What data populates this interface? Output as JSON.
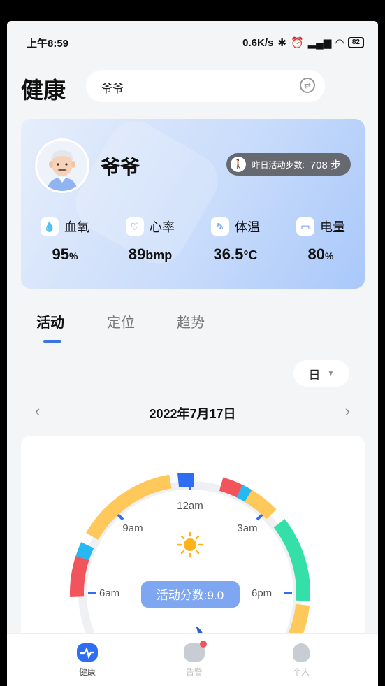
{
  "status": {
    "time": "上午8:59",
    "net_speed": "0.6K/s",
    "battery": "82"
  },
  "header": {
    "title": "健康",
    "search_value": "爷爷"
  },
  "profile": {
    "name": "爷爷",
    "steps_label": "昨日活动步数:",
    "steps_value": "708 步"
  },
  "metrics": [
    {
      "label": "血氧",
      "value": "95",
      "unit": "%",
      "icon": "droplet-icon"
    },
    {
      "label": "心率",
      "value": "89",
      "unit": "bmp",
      "icon": "heart-pulse-icon"
    },
    {
      "label": "体温",
      "value": "36.5",
      "unit": "°C",
      "icon": "thermometer-icon"
    },
    {
      "label": "电量",
      "value": "80",
      "unit": "%",
      "icon": "battery-icon"
    }
  ],
  "tabs": [
    {
      "label": "活动",
      "active": true
    },
    {
      "label": "定位",
      "active": false
    },
    {
      "label": "趋势",
      "active": false
    }
  ],
  "period": {
    "selected": "日"
  },
  "date": {
    "text": "2022年7月17日"
  },
  "chart": {
    "score_text": "活动分数:9.0",
    "labels": {
      "top": "12am",
      "tl": "9am",
      "tr": "3am",
      "left": "6am",
      "right": "6pm"
    },
    "colors": {
      "yellow": "#ffc85a",
      "blue": "#2f6ef0",
      "red": "#f2545b",
      "cyan": "#26b8f0",
      "green": "#34dfa8",
      "track": "#eef0f4",
      "badge": "#7fa6f0"
    }
  },
  "nav": [
    {
      "label": "健康",
      "icon": "heart-pulse-icon",
      "active": true
    },
    {
      "label": "告警",
      "icon": "alert-chat-icon",
      "active": false
    },
    {
      "label": "个人",
      "icon": "person-icon",
      "active": false
    }
  ]
}
